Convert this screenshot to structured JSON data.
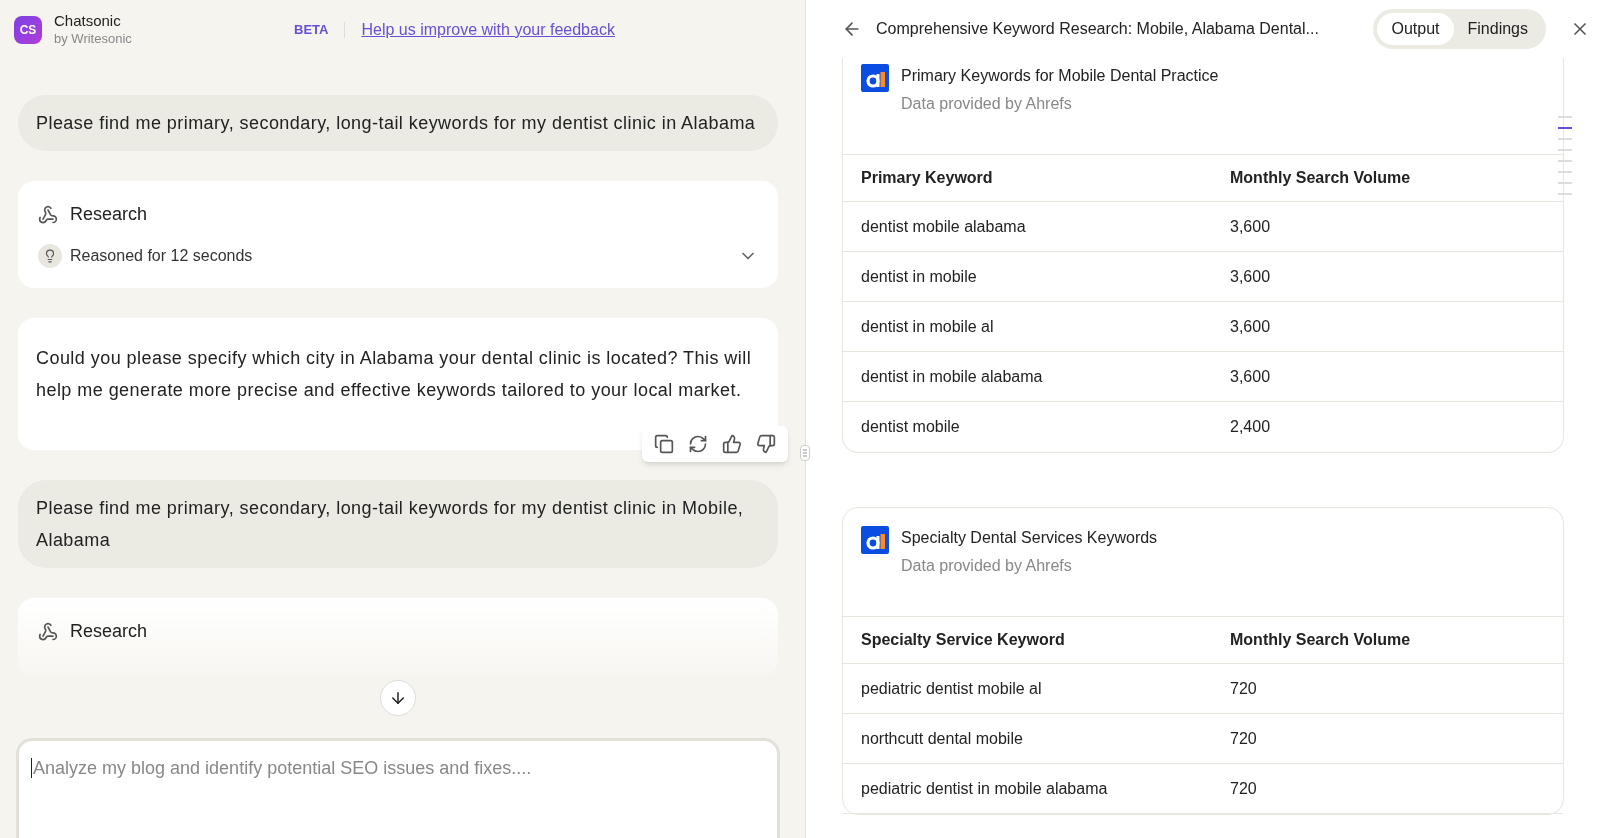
{
  "app": {
    "logo_text": "CS",
    "name": "Chatsonic",
    "byline": "by Writesonic",
    "badge": "BETA",
    "feedback_link": "Help us improve with your feedback"
  },
  "chat": [
    {
      "kind": "user",
      "text": "Please find me primary, secondary, long-tail keywords for my dentist clinic in Alabama"
    },
    {
      "kind": "research",
      "title": "Research",
      "reasoning": "Reasoned for 12 seconds",
      "expanded": false
    },
    {
      "kind": "assistant",
      "text": "Could you please specify which city in Alabama your dental clinic is located? This will help me generate more precise and effective keywords tailored to your local market."
    },
    {
      "kind": "user",
      "text": "Please find me primary, secondary, long-tail keywords for my dentist clinic in Mobile, Alabama"
    },
    {
      "kind": "research",
      "title": "Research"
    }
  ],
  "composer": {
    "placeholder": "Analyze my blog and identify potential SEO issues and fixes...."
  },
  "panel": {
    "title": "Comprehensive Keyword Research: Mobile, Alabama Dental...",
    "tabs": [
      {
        "label": "Output",
        "selected": true
      },
      {
        "label": "Findings",
        "selected": false
      }
    ],
    "cards": [
      {
        "title": "Primary Keywords for Mobile Dental Practice",
        "source": "Data provided by Ahrefs",
        "columns": [
          "Primary Keyword",
          "Monthly Search Volume"
        ],
        "rows": [
          [
            "dentist mobile alabama",
            "3,600"
          ],
          [
            "dentist in mobile",
            "3,600"
          ],
          [
            "dentist in mobile al",
            "3,600"
          ],
          [
            "dentist in mobile alabama",
            "3,600"
          ],
          [
            "dentist mobile",
            "2,400"
          ]
        ]
      },
      {
        "title": "Specialty Dental Services Keywords",
        "source": "Data provided by Ahrefs",
        "columns": [
          "Specialty Service Keyword",
          "Monthly Search Volume"
        ],
        "rows": [
          [
            "pediatric dentist mobile al",
            "720"
          ],
          [
            "northcutt dental mobile",
            "720"
          ],
          [
            "pediatric dentist in mobile alabama",
            "720"
          ]
        ]
      }
    ]
  }
}
